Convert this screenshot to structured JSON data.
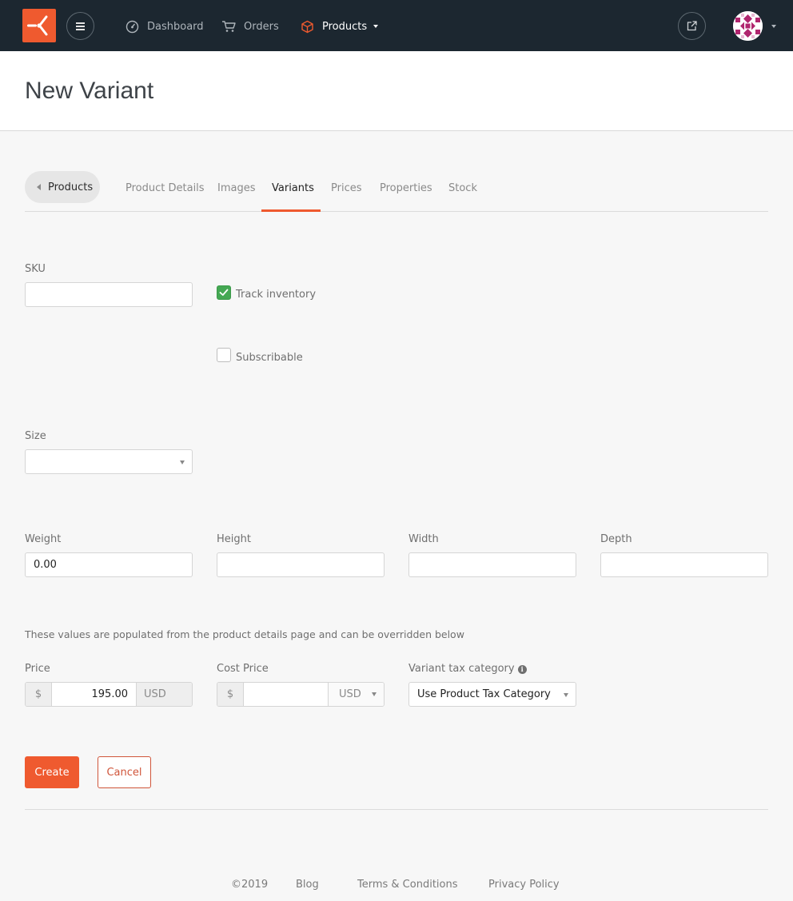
{
  "nav": {
    "items": [
      {
        "label": "Dashboard",
        "icon": "dashboard-icon"
      },
      {
        "label": "Orders",
        "icon": "cart-icon"
      },
      {
        "label": "Products",
        "icon": "cube-icon"
      }
    ],
    "brand_color": "#ef5a2f"
  },
  "header": {
    "title": "New Variant"
  },
  "tabs": {
    "back_label": "Products",
    "items": [
      "Product Details",
      "Images",
      "Variants",
      "Prices",
      "Properties",
      "Stock"
    ],
    "active": "Variants"
  },
  "form": {
    "sku": {
      "label": "SKU",
      "value": ""
    },
    "track_inventory": {
      "label": "Track inventory",
      "checked": true
    },
    "subscribable": {
      "label": "Subscribable",
      "checked": false
    },
    "size": {
      "label": "Size",
      "value": ""
    },
    "weight": {
      "label": "Weight",
      "value": "0.00"
    },
    "height": {
      "label": "Height",
      "value": ""
    },
    "width": {
      "label": "Width",
      "value": ""
    },
    "depth": {
      "label": "Depth",
      "value": ""
    },
    "note": "These values are populated from the product details page and can be overridden below",
    "price": {
      "label": "Price",
      "prefix": "$",
      "value": "195.00",
      "currency": "USD"
    },
    "cost_price": {
      "label": "Cost Price",
      "prefix": "$",
      "value": "",
      "currency": "USD"
    },
    "tax_category": {
      "label": "Variant tax category",
      "value": "Use Product Tax Category"
    },
    "create_label": "Create",
    "cancel_label": "Cancel"
  },
  "footer": {
    "copyright": "©2019",
    "links": [
      "Blog",
      "Terms & Conditions",
      "Privacy Policy"
    ]
  }
}
